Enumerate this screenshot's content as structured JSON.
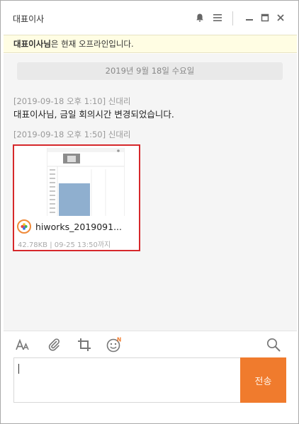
{
  "window": {
    "title": "대표이사"
  },
  "notice": {
    "name": "대표이사님",
    "suffix": "은 현재 오프라인입니다."
  },
  "chat": {
    "date_divider": "2019년 9월 18일 수요일",
    "messages": [
      {
        "meta": "[2019-09-18 오후 1:10] 신대리",
        "text": "대표이사님, 금일 회의시간 변경되었습니다."
      },
      {
        "meta": "[2019-09-18 오후 1:50] 신대리"
      }
    ],
    "file": {
      "name": "hiworks_2019091...",
      "info": "42.78KB | 09-25 13:50까지"
    }
  },
  "toolbar": {
    "emoji_badge": "N"
  },
  "send": {
    "label": "전송"
  },
  "colors": {
    "accent": "#f07b2d",
    "highlight": "#d6282b",
    "notice_bg": "#fffde3"
  },
  "icons": [
    "bell-icon",
    "menu-icon",
    "minimize-icon",
    "maximize-icon",
    "close-icon",
    "font-icon",
    "attach-icon",
    "crop-icon",
    "emoji-icon",
    "search-icon"
  ]
}
